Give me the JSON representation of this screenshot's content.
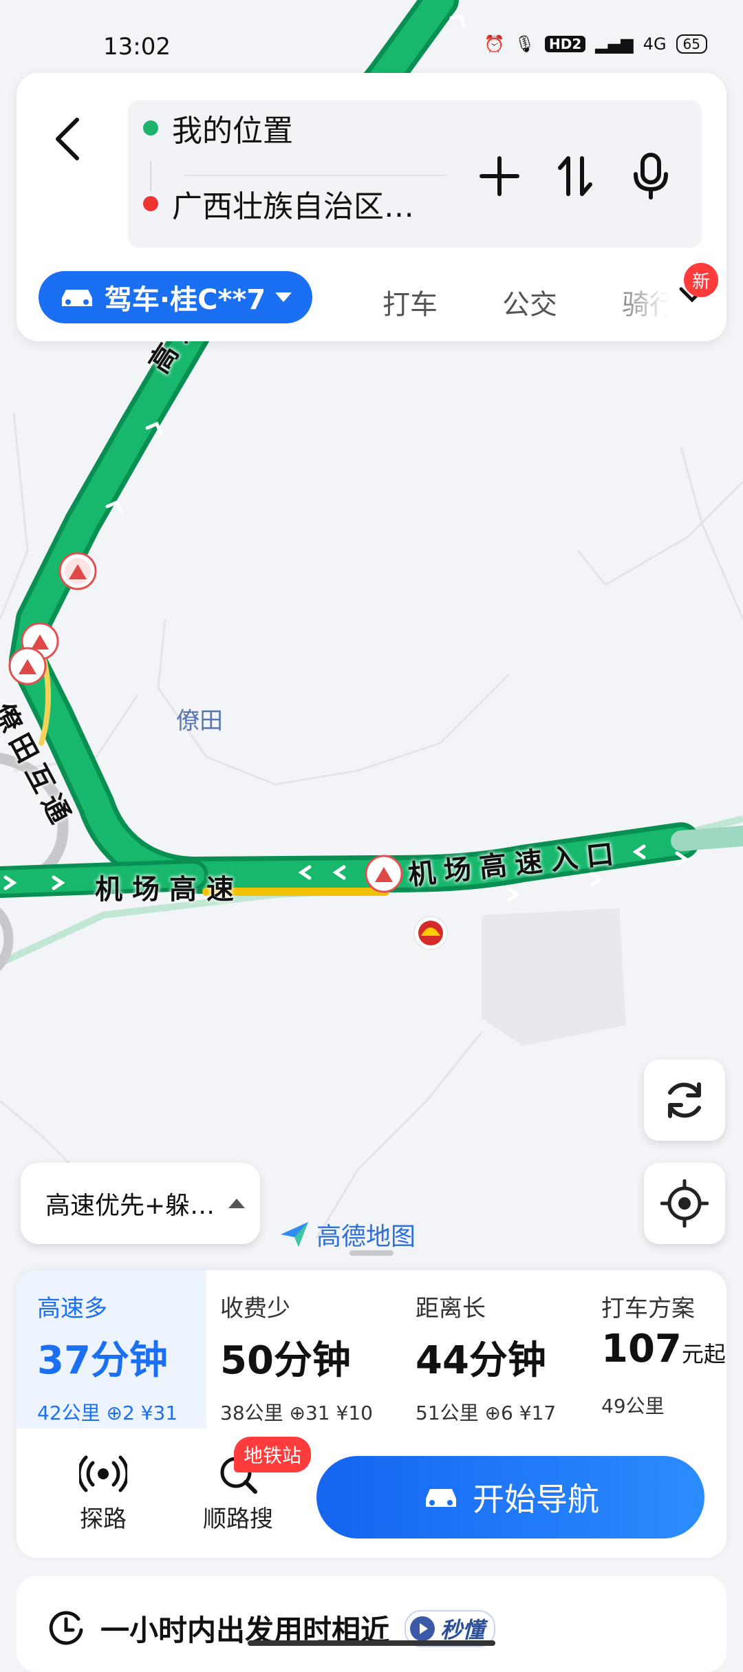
{
  "status_bar": {
    "time": "13:02",
    "hd_label": "HD2",
    "net_label": "4G",
    "battery": "65"
  },
  "header": {
    "origin": "我的位置",
    "destination": "广西壮族自治区…",
    "modes": {
      "drive": "驾车·桂C**7",
      "taxi": "打车",
      "bus": "公交",
      "ride": "骑行",
      "more_badge": "新"
    }
  },
  "map": {
    "road_labels": {
      "highway_top": "高速",
      "interchange": "僚田互通",
      "airport_highway": "机场高速",
      "airport_entrance": "机场高速入口"
    },
    "place_label": "僚田",
    "route_preference": "高速优先+躲…",
    "logo_text": "高德地图"
  },
  "routes": [
    {
      "title": "高速多",
      "time": "37分钟",
      "meta": "42公里 ⊕2 ¥31"
    },
    {
      "title": "收费少",
      "time": "50分钟",
      "meta": "38公里 ⊕31 ¥10"
    },
    {
      "title": "距离长",
      "time": "44分钟",
      "meta": "51公里 ⊕6 ¥17"
    },
    {
      "title": "打车方案",
      "price": "107",
      "price_unit": "元起",
      "meta": "49公里"
    }
  ],
  "actions": {
    "explore": "探路",
    "along_search": "顺路搜",
    "metro_badge": "地铁站",
    "start_nav": "开始导航"
  },
  "bottom_card": {
    "text": "一小时内出发用时相近",
    "badge": "秒懂"
  },
  "colors": {
    "accent": "#1a6ff2",
    "route_green": "#14b368",
    "route_edge": "#0a8f52"
  }
}
